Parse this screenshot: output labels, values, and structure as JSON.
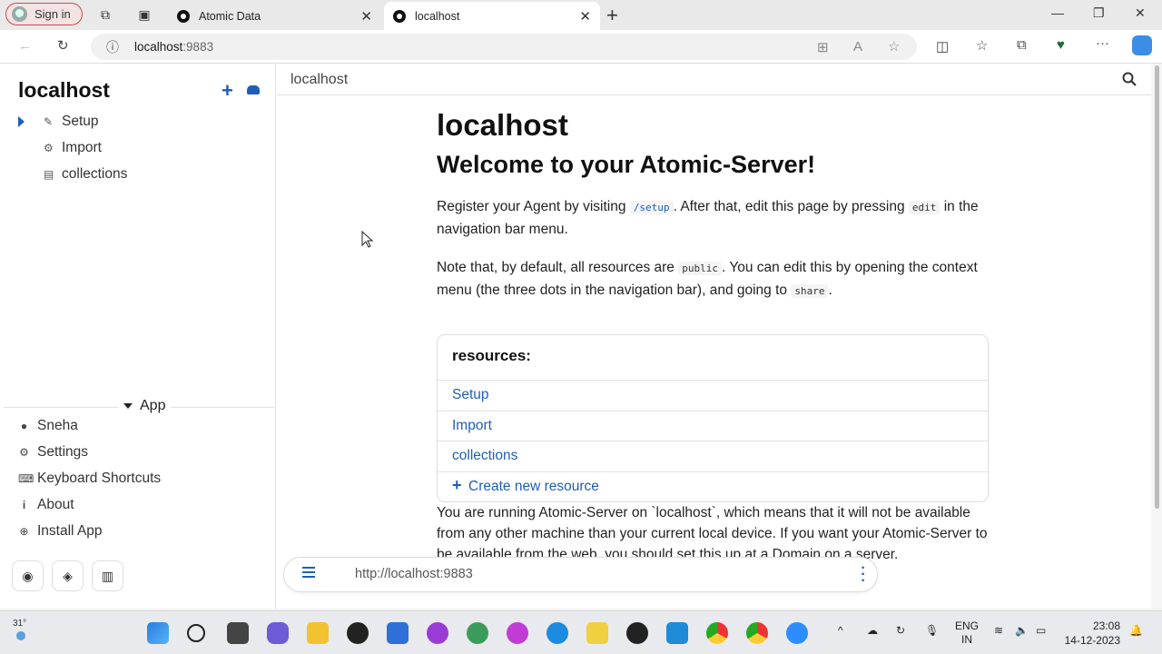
{
  "browser": {
    "signin_label": "Sign in",
    "tabs": [
      {
        "title": "Atomic Data",
        "active": false
      },
      {
        "title": "localhost",
        "active": true
      }
    ],
    "url_host": "localhost",
    "url_port": ":9883"
  },
  "sidebar": {
    "title": "localhost",
    "items": [
      {
        "label": "Setup",
        "icon": "edit-icon"
      },
      {
        "label": "Import",
        "icon": "gear-icon"
      },
      {
        "label": "collections",
        "icon": "list-icon"
      }
    ],
    "app_section": "App",
    "app_links": [
      {
        "label": "Sneha",
        "icon": "user-icon"
      },
      {
        "label": "Settings",
        "icon": "gear-icon"
      },
      {
        "label": "Keyboard Shortcuts",
        "icon": "keyboard-icon"
      },
      {
        "label": "About",
        "icon": "info-icon"
      },
      {
        "label": "Install App",
        "icon": "plus-circle-icon"
      }
    ],
    "social": [
      "github-icon",
      "discord-icon",
      "book-icon"
    ]
  },
  "main": {
    "breadcrumb": "localhost",
    "heading": "localhost",
    "subheading": "Welcome to your Atomic-Server!",
    "p1_a": "Register your Agent by visiting ",
    "p1_code1": "/setup",
    "p1_b": ". After that, edit this page by pressing ",
    "p1_code2": "edit",
    "p1_c": " in the navigation bar menu.",
    "p2_a": "Note that, by default, all resources are ",
    "p2_code1": "public",
    "p2_b": ". You can edit this by opening the context menu (the three dots in the navigation bar), and going to ",
    "p2_code2": "share",
    "p2_c": ".",
    "resources_title": "resources:",
    "resources": [
      "Setup",
      "Import",
      "collections"
    ],
    "create_label": "Create new resource",
    "p3": "You are running Atomic-Server on `localhost`, which means that it will not be available from any other machine than your current local device. If you want your Atomic-Server to be available from the web, you should set this up at a Domain on a server."
  },
  "navbar": {
    "url": "http://localhost:9883"
  },
  "taskbar": {
    "temperature": "31°",
    "lang_top": "ENG",
    "lang_bottom": "IN",
    "time": "23:08",
    "date": "14-12-2023"
  },
  "colors": {
    "accent": "#1e5eb8"
  }
}
